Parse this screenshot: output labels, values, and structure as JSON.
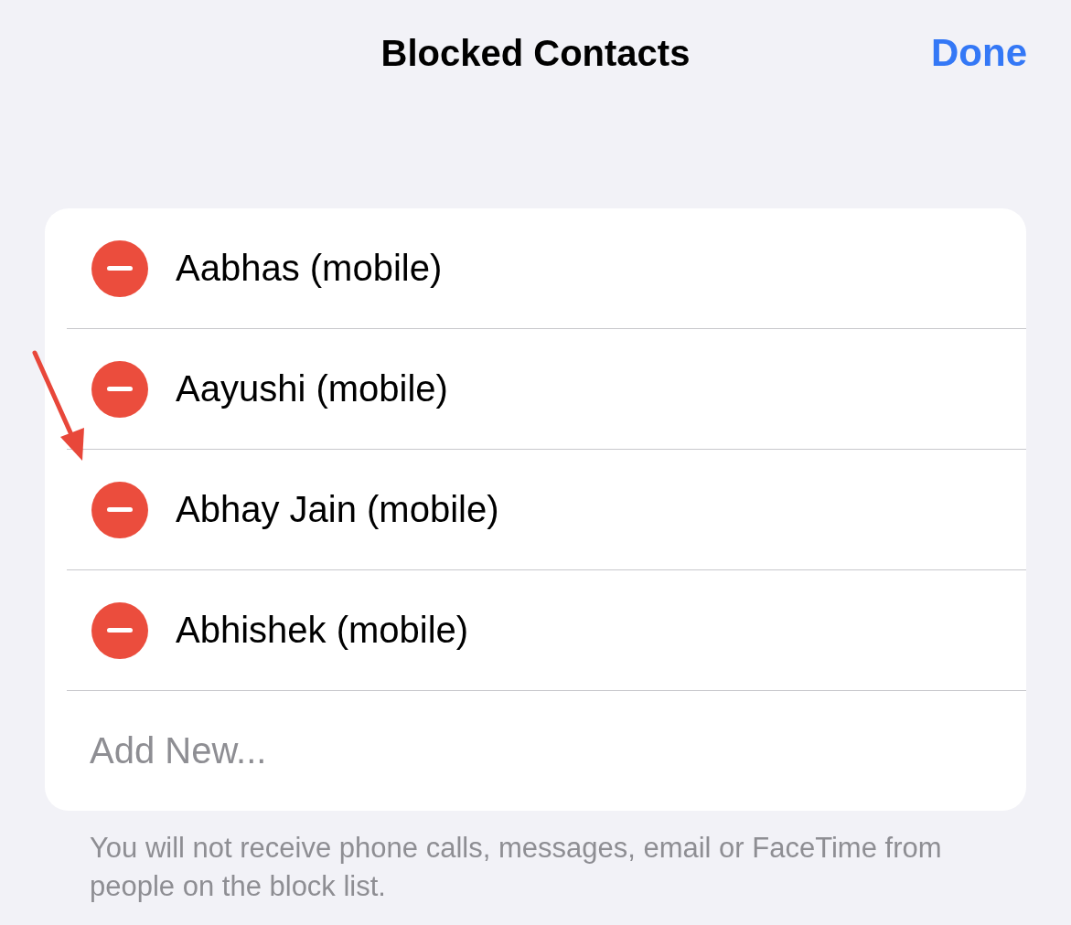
{
  "header": {
    "title": "Blocked Contacts",
    "done": "Done"
  },
  "contacts": [
    {
      "name": "Aabhas (mobile)"
    },
    {
      "name": "Aayushi (mobile)"
    },
    {
      "name": "Abhay Jain (mobile)"
    },
    {
      "name": "Abhishek (mobile)"
    }
  ],
  "add_new": "Add New...",
  "footer": "You will not receive phone calls, messages, email or FaceTime from people on the block list."
}
